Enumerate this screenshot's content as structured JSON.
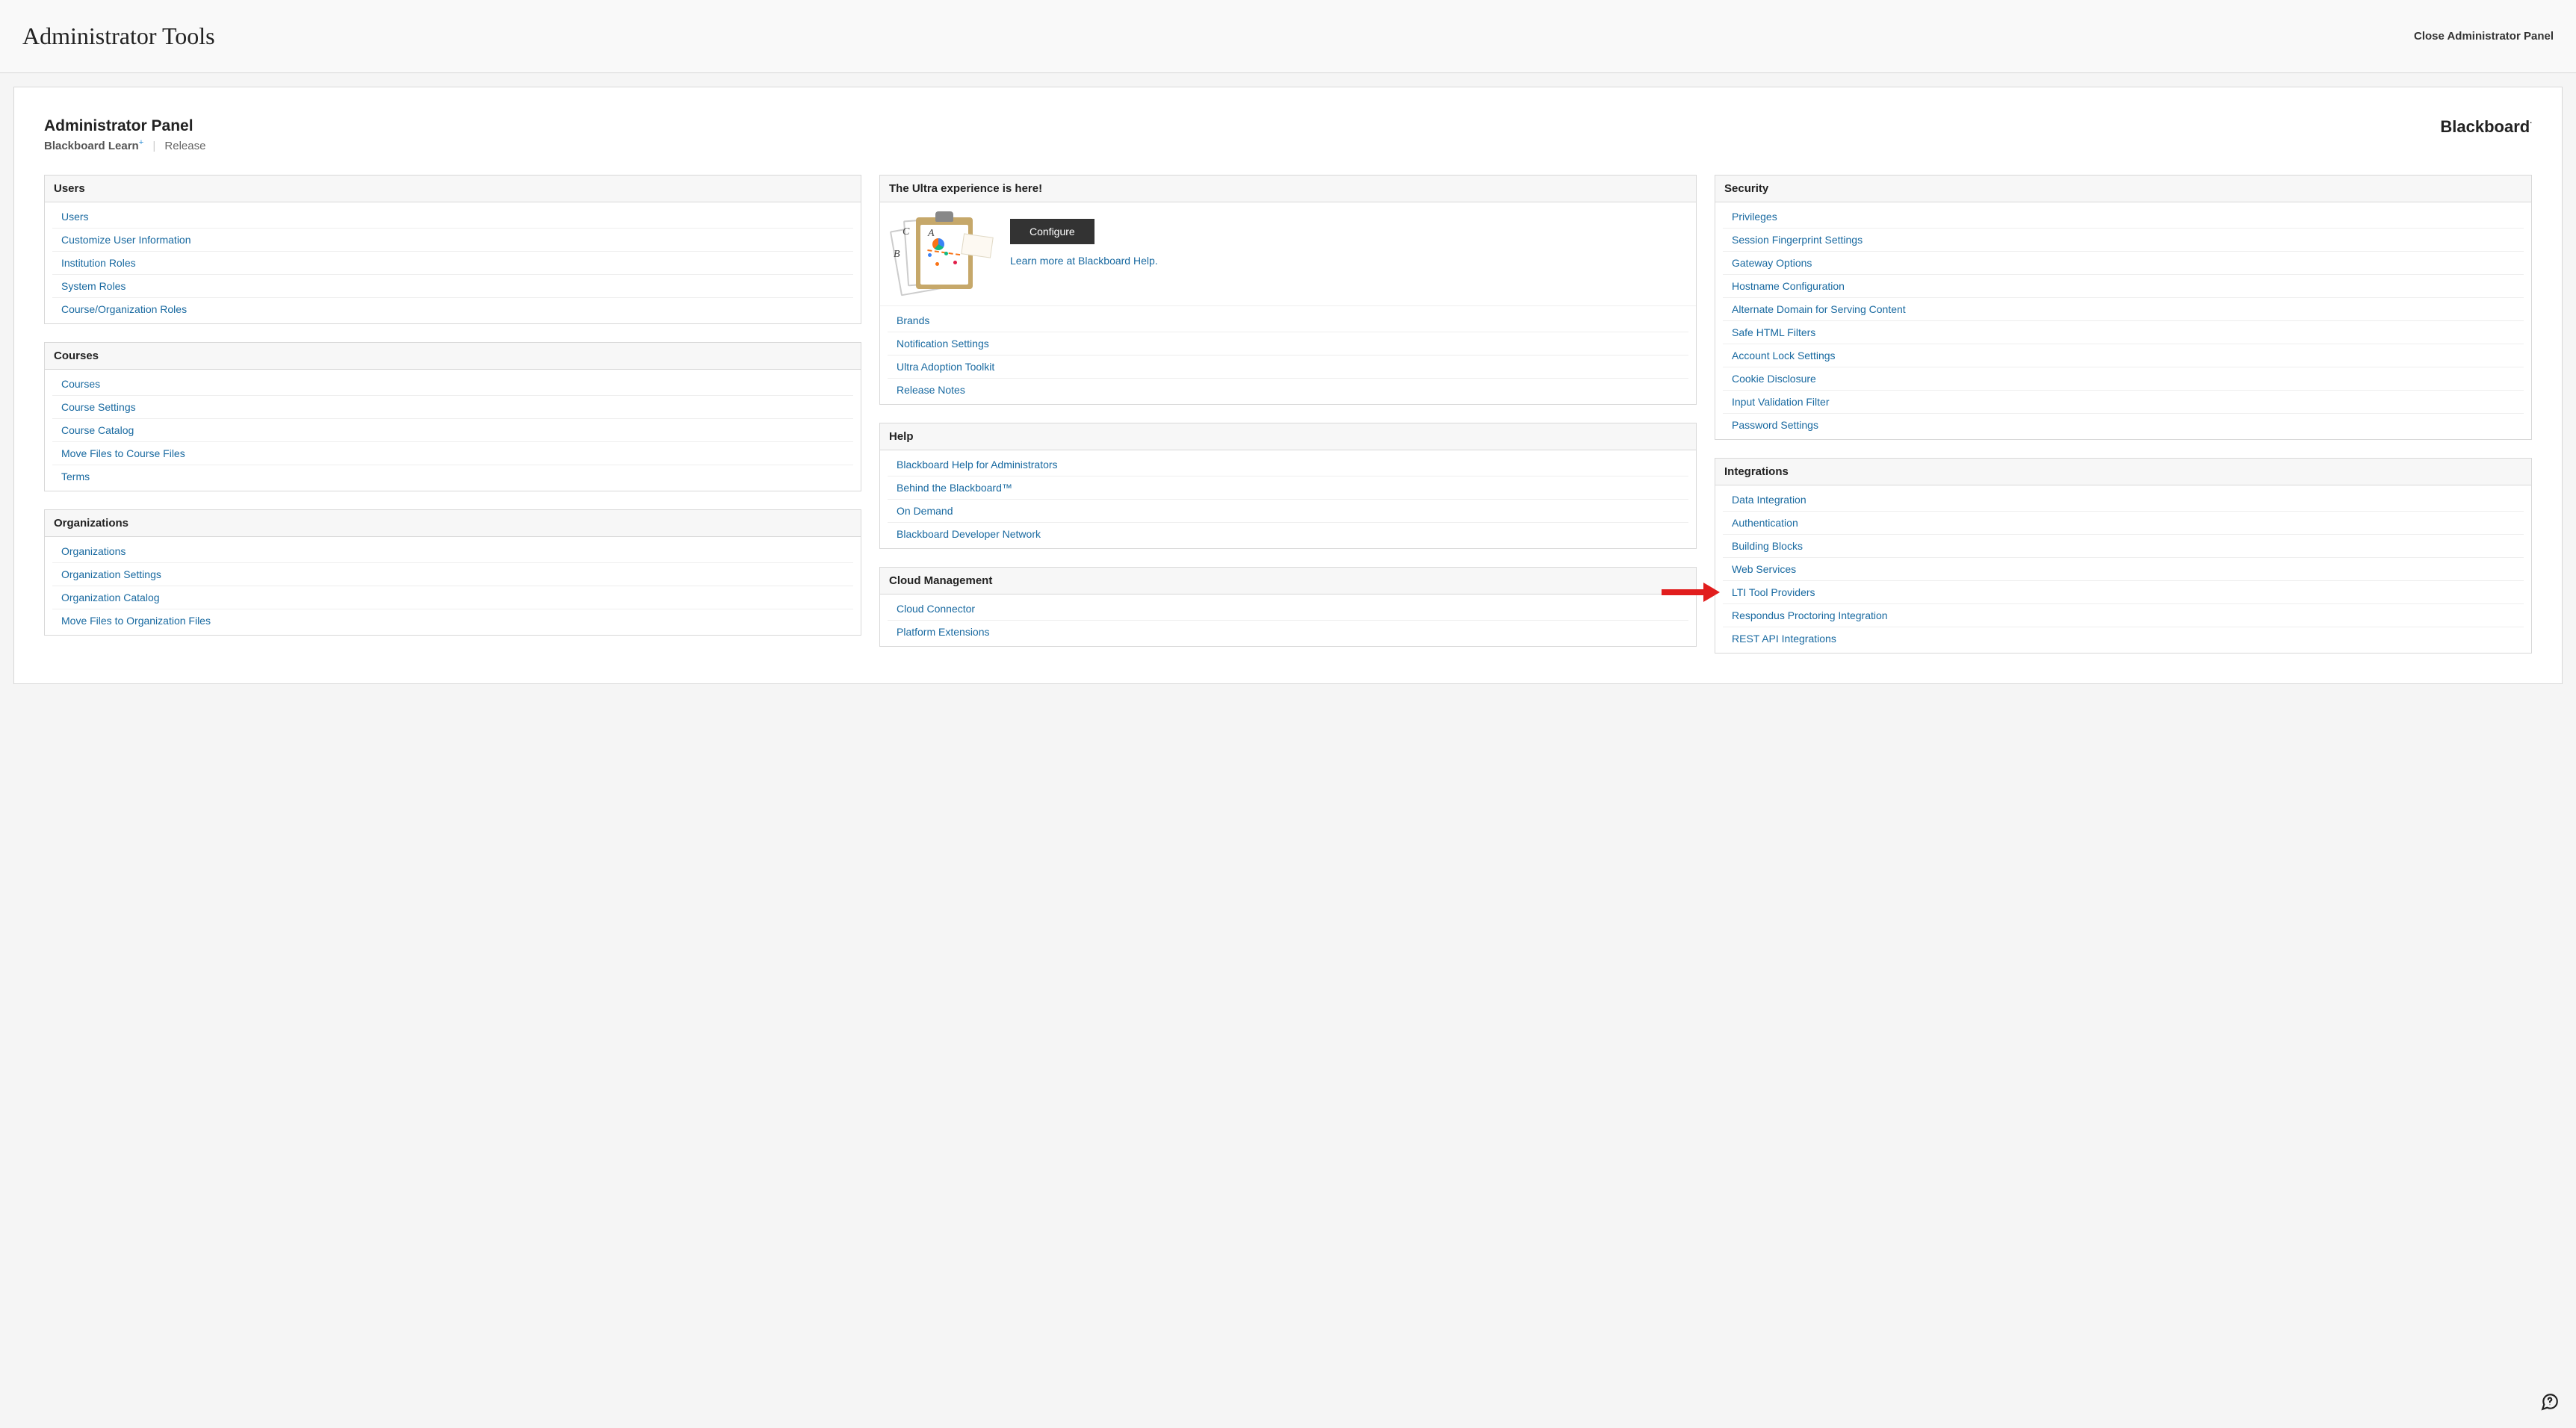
{
  "topbar": {
    "title": "Administrator Tools",
    "close": "Close Administrator Panel"
  },
  "panel": {
    "heading": "Administrator Panel",
    "product": "Blackboard Learn",
    "plus": "+",
    "release": "Release",
    "brand": "Blackboard"
  },
  "col1": {
    "users": {
      "title": "Users",
      "items": [
        "Users",
        "Customize User Information",
        "Institution Roles",
        "System Roles",
        "Course/Organization Roles"
      ]
    },
    "courses": {
      "title": "Courses",
      "items": [
        "Courses",
        "Course Settings",
        "Course Catalog",
        "Move Files to Course Files",
        "Terms"
      ]
    },
    "orgs": {
      "title": "Organizations",
      "items": [
        "Organizations",
        "Organization Settings",
        "Organization Catalog",
        "Move Files to Organization Files"
      ]
    }
  },
  "col2": {
    "ultra": {
      "title": "The Ultra experience is here!",
      "configure": "Configure",
      "learn": "Learn more at Blackboard Help.",
      "items": [
        "Brands",
        "Notification Settings",
        "Ultra Adoption Toolkit",
        "Release Notes"
      ]
    },
    "help": {
      "title": "Help",
      "items": [
        "Blackboard Help for Administrators",
        "Behind the Blackboard™",
        "On Demand",
        "Blackboard Developer Network"
      ]
    },
    "cloud": {
      "title": "Cloud Management",
      "items": [
        "Cloud Connector",
        "Platform Extensions"
      ]
    }
  },
  "col3": {
    "security": {
      "title": "Security",
      "items": [
        "Privileges",
        "Session Fingerprint Settings",
        "Gateway Options",
        "Hostname Configuration",
        "Alternate Domain for Serving Content",
        "Safe HTML Filters",
        "Account Lock Settings",
        "Cookie Disclosure",
        "Input Validation Filter",
        "Password Settings"
      ]
    },
    "integrations": {
      "title": "Integrations",
      "items": [
        "Data Integration",
        "Authentication",
        "Building Blocks",
        "Web Services",
        "LTI Tool Providers",
        "Respondus Proctoring Integration",
        "REST API Integrations"
      ]
    }
  }
}
